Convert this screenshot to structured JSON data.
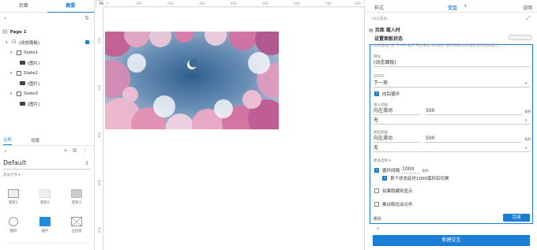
{
  "left": {
    "tabs": [
      "页面",
      "概要"
    ],
    "tree": {
      "page": "Page 1",
      "panel": "(动态面板)",
      "states": [
        {
          "label": "State1",
          "child": "(图片)"
        },
        {
          "label": "State2",
          "child": "(图片)"
        },
        {
          "label": "State3",
          "child": "(图片)"
        }
      ]
    },
    "library_tabs": [
      "元件",
      "母版"
    ],
    "library_select": "Default",
    "category": "基本元件 ▾",
    "widgets": [
      "矩形1",
      "矩形2",
      "矩形3",
      "圆形",
      "图片",
      "占位符"
    ]
  },
  "canvas": {
    "page_tab": "Page 1",
    "ruler_top": [
      "0",
      "100",
      "200",
      "300",
      "400",
      "500",
      "600",
      "700",
      "800"
    ],
    "ruler_left": [
      "100",
      "200",
      "300",
      "400",
      "500"
    ]
  },
  "right": {
    "tabs": [
      "样式",
      "交互",
      "说明"
    ],
    "active_tab": "交互",
    "panel_name": "(动态面板)",
    "event_title": "页面 载入时",
    "action_title": "设置面板状态",
    "action_badge": "",
    "summary": "(动态面板) 到 下一项 循环 向左滑动 500毫秒 循环间隔1000毫秒首次变换延时",
    "target_label": "目标",
    "target_value": "(动态面板)",
    "state_label": "STATE",
    "state_value": "下一项",
    "loop_label": "向后循环",
    "enter_label": "进入动画",
    "enter_anim": "向左滑动",
    "enter_ms": "500",
    "enter_unit": "毫秒",
    "enter_ease": "无",
    "exit_label": "退出动画",
    "exit_anim": "向左滑动",
    "exit_ms": "500",
    "exit_unit": "毫秒",
    "exit_ease": "无",
    "more_label": "更多选项 ▾",
    "repeat_label": "循环间隔",
    "repeat_ms": "1000",
    "repeat_unit": "毫秒",
    "first_delay_label": "首个状态延时1000毫秒后切换",
    "hide_label": "如果隐藏则显示",
    "push_label": "推动和拉动元件",
    "delete_label": "删除",
    "done_label": "完成",
    "plus_label": "+",
    "new_interaction_label": "新建交互"
  }
}
